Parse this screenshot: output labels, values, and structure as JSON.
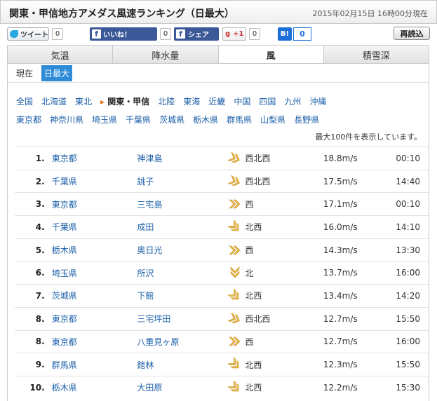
{
  "header": {
    "title": "関東・甲信地方アメダス風速ランキング（日最大）",
    "datetime": "2015年02月15日 16時00分現在"
  },
  "social": {
    "tweet_label": "ツイート",
    "tweet_count": "0",
    "like_label": "いいね！",
    "like_count": "0",
    "share_label": "シェア",
    "gplus_label": "+1",
    "gplus_count": "0",
    "hatena_label": "B!",
    "hatena_count": "0",
    "reload_label": "再読込"
  },
  "tabs": [
    {
      "label": "気温"
    },
    {
      "label": "降水量"
    },
    {
      "label": "風"
    },
    {
      "label": "積雪深"
    }
  ],
  "subtabs": [
    {
      "label": "現在"
    },
    {
      "label": "日最大"
    }
  ],
  "regions_row1": [
    "全国",
    "北海道",
    "東北",
    "関東・甲信",
    "北陸",
    "東海",
    "近畿",
    "中国",
    "四国",
    "九州",
    "沖縄"
  ],
  "regions_row2": [
    "東京都",
    "神奈川県",
    "埼玉県",
    "千葉県",
    "茨城県",
    "栃木県",
    "群馬県",
    "山梨県",
    "長野県"
  ],
  "note": "最大100件を表示しています。",
  "rows": [
    {
      "rank": "1.",
      "pref": "東京都",
      "site": "神津島",
      "dir": "西北西",
      "speed": "18.8m/s",
      "time": "00:10"
    },
    {
      "rank": "2.",
      "pref": "千葉県",
      "site": "銚子",
      "dir": "西北西",
      "speed": "17.5m/s",
      "time": "14:40"
    },
    {
      "rank": "3.",
      "pref": "東京都",
      "site": "三宅島",
      "dir": "西",
      "speed": "17.1m/s",
      "time": "00:10"
    },
    {
      "rank": "4.",
      "pref": "千葉県",
      "site": "成田",
      "dir": "北西",
      "speed": "16.0m/s",
      "time": "14:10"
    },
    {
      "rank": "5.",
      "pref": "栃木県",
      "site": "奥日光",
      "dir": "西",
      "speed": "14.3m/s",
      "time": "13:30"
    },
    {
      "rank": "6.",
      "pref": "埼玉県",
      "site": "所沢",
      "dir": "北",
      "speed": "13.7m/s",
      "time": "16:00"
    },
    {
      "rank": "7.",
      "pref": "茨城県",
      "site": "下館",
      "dir": "北西",
      "speed": "13.4m/s",
      "time": "14:20"
    },
    {
      "rank": "8.",
      "pref": "東京都",
      "site": "三宅坪田",
      "dir": "西北西",
      "speed": "12.7m/s",
      "time": "15:50"
    },
    {
      "rank": "8.",
      "pref": "東京都",
      "site": "八重見ヶ原",
      "dir": "西",
      "speed": "12.7m/s",
      "time": "16:00"
    },
    {
      "rank": "9.",
      "pref": "群馬県",
      "site": "館林",
      "dir": "北西",
      "speed": "12.3m/s",
      "time": "15:50"
    },
    {
      "rank": "10.",
      "pref": "栃木県",
      "site": "大田原",
      "dir": "北西",
      "speed": "12.2m/s",
      "time": "15:30"
    }
  ],
  "colors": {
    "accent": "#2d8bd8",
    "link": "#1a5ea8",
    "arrow": "#e8b84a",
    "facebook": "#3b5998"
  }
}
